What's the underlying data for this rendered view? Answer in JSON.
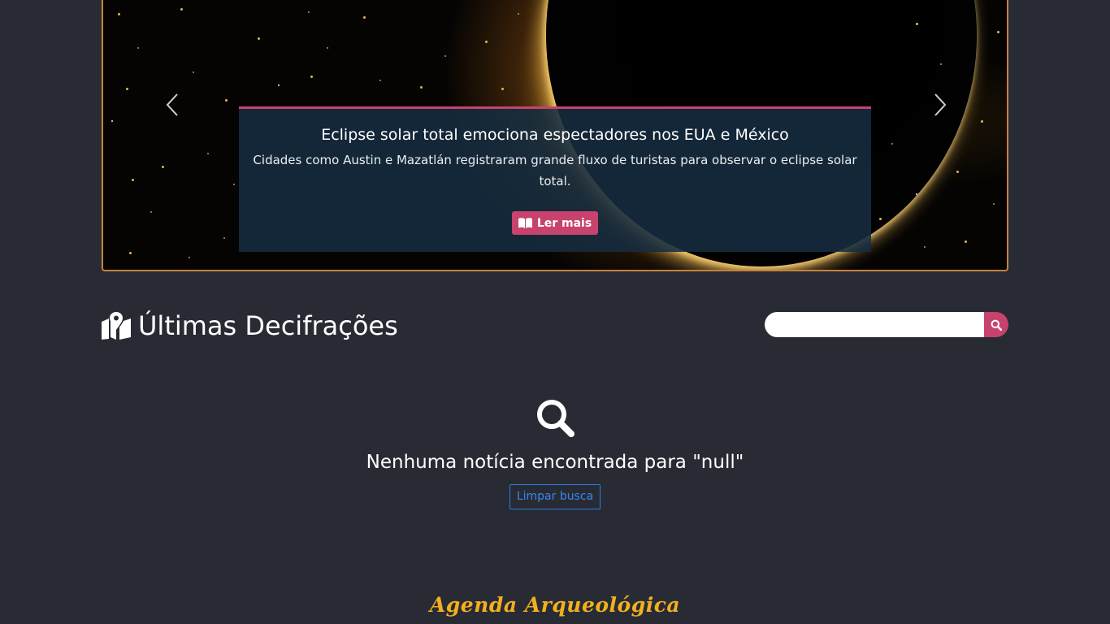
{
  "carousel": {
    "prev_icon": "chevron-left-icon",
    "next_icon": "chevron-right-icon",
    "slide": {
      "title": "Eclipse solar total emociona espectadores nos EUA e México",
      "description": "Cidades como Austin e Mazatlán registraram grande fluxo de turistas para observar o eclipse solar total.",
      "read_more_label": "Ler mais",
      "read_more_icon": "book-open-icon"
    }
  },
  "section": {
    "title": "Últimas Decifrações",
    "icon": "map-marked-icon"
  },
  "search": {
    "value": "",
    "placeholder": "",
    "icon": "search-icon"
  },
  "empty_state": {
    "icon": "search-icon",
    "message": "Nenhuma notícia encontrada para \"null\"",
    "clear_label": "Limpar busca"
  },
  "footer": {
    "title": "Agenda Arqueológica"
  },
  "colors": {
    "background": "#282b34",
    "accent": "#c7436d",
    "carousel_border": "#c8823a",
    "link_blue": "#3a86ee",
    "footer_gold": "#f2b01e"
  }
}
